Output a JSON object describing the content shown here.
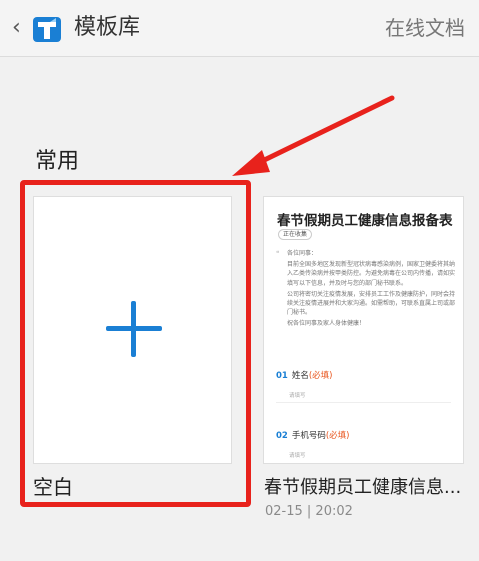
{
  "header": {
    "back_icon": "chevron-left-icon",
    "logo_icon": "app-logo-icon",
    "title": "模板库",
    "right_link": "在线文档",
    "logo_color": "#1a7fd4"
  },
  "section": {
    "title": "常用"
  },
  "blank_card": {
    "label": "空白",
    "icon": "plus-icon",
    "accent": "#1a7fd4"
  },
  "template_card": {
    "preview_title": "春节假期员工健康信息报备表",
    "status_badge": "正在收集",
    "intro_lines": [
      "各位同事：",
      "目前全国多地区发现新型冠状病毒感染病例，国家卫健委将其纳入乙类传染病并按甲类防控。为避免病毒在公司内传播，请如实填写以下信息，并及时与您的部门秘书联系。",
      "公司将密切关注疫情发展，安排员工工作及健康防护，同时会持续关注疫情进展并和大家沟通。如需帮助，可联系直属上司或部门秘书。",
      "祝各位同事及家人身体健康！"
    ],
    "questions": [
      {
        "num": "01",
        "label": "姓名",
        "required": "(必填)",
        "hint": "请填写"
      },
      {
        "num": "02",
        "label": "手机号码",
        "required": "(必填)",
        "hint": "请填写"
      }
    ],
    "name": "春节假期员工健康信息...",
    "date": "02-15 | 20:02"
  },
  "annotation": {
    "color": "#e8221c"
  }
}
